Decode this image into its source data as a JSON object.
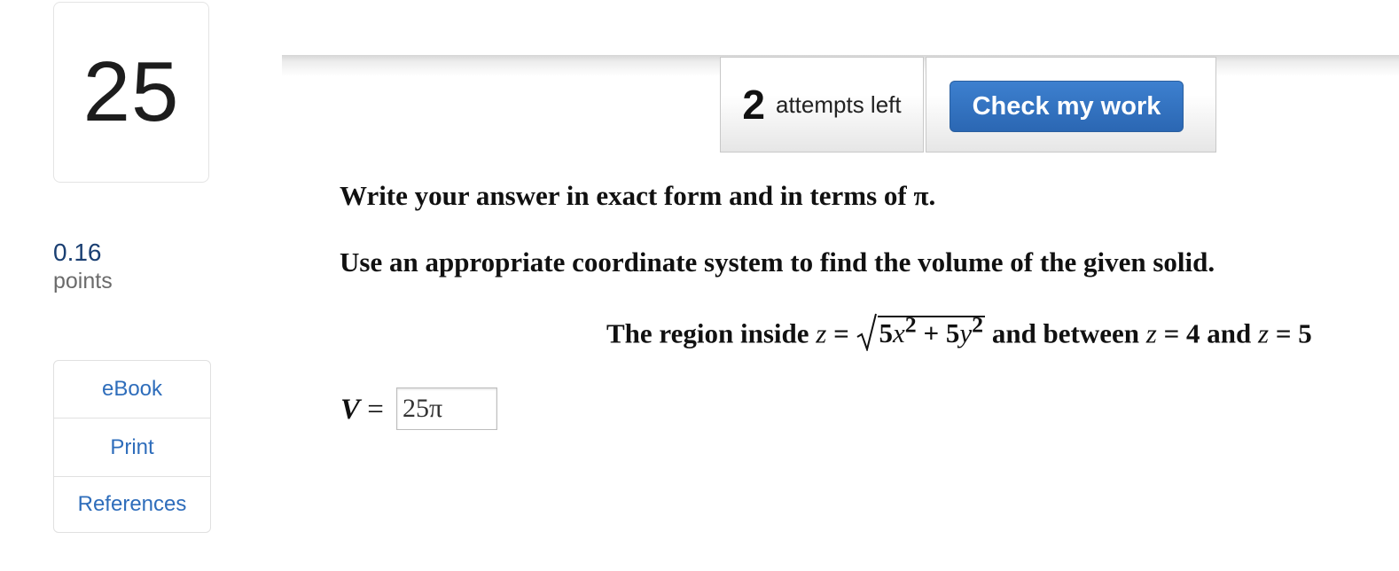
{
  "question": {
    "number": "25",
    "points_value": "0.16",
    "points_label": "points"
  },
  "tools": [
    {
      "label": "eBook"
    },
    {
      "label": "Print"
    },
    {
      "label": "References"
    }
  ],
  "attempts": {
    "count": "2",
    "label": "attempts left"
  },
  "check_button": {
    "label": "Check my work"
  },
  "instructions": {
    "line1": "Write your answer in exact form and in terms of π.",
    "line2": "Use an appropriate coordinate system to find the volume of the given solid."
  },
  "region": {
    "prefix": "The region inside ",
    "z1": "z",
    "eq": " = ",
    "radicand_a": "5",
    "radicand_x": "x",
    "exp2": "2",
    "plus": " + 5",
    "radicand_y": "y",
    "between": " and between ",
    "z2": "z",
    "eq4": " = 4 and ",
    "z3": "z",
    "eq5": " = 5"
  },
  "answer": {
    "label_var": "V",
    "label_eq": " =",
    "value": "25π"
  }
}
